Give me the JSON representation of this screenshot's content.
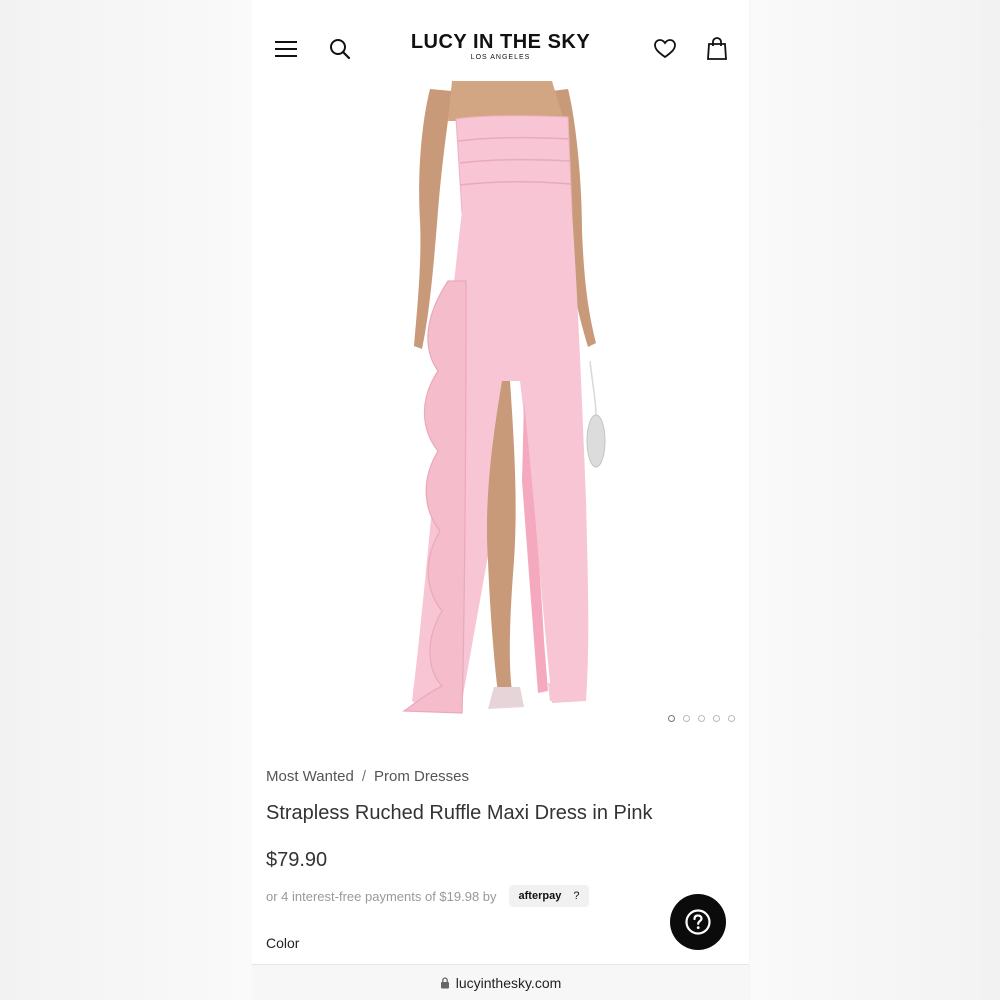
{
  "header": {
    "brand_name": "LUCY IN THE SKY",
    "brand_location": "LOS ANGELES",
    "icons": [
      "menu-icon",
      "search-icon",
      "heart-icon",
      "bag-icon"
    ]
  },
  "gallery": {
    "image_count": 5,
    "active_index": 0,
    "dress_color": "#f7c5d3"
  },
  "product": {
    "breadcrumb": [
      "Most Wanted",
      "Prom Dresses"
    ],
    "breadcrumb_separator": "/",
    "title": "Strapless Ruched Ruffle Maxi Dress in Pink",
    "price": "$79.90",
    "afterpay_text": "or 4 interest-free payments of $19.98 by",
    "afterpay_label": "afterpay",
    "afterpay_help": "?",
    "color_label": "Color"
  },
  "browser": {
    "url": "lucyinthesky.com"
  },
  "colors": {
    "help_button": "#0b0b0b",
    "text": "#333333"
  }
}
